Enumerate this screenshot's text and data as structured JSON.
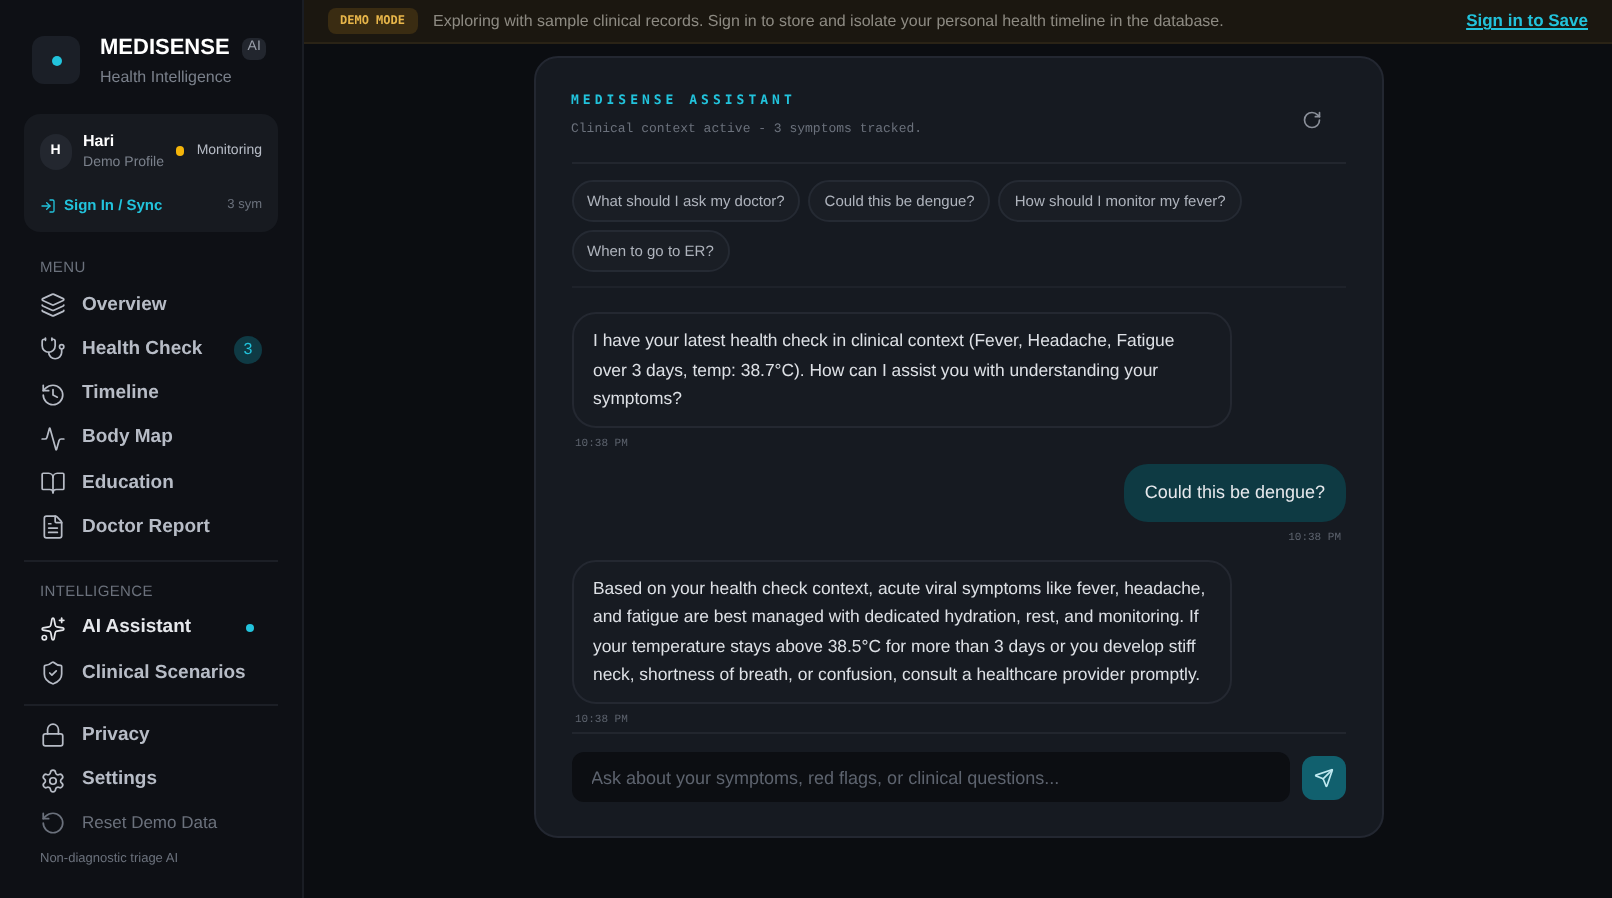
{
  "brand": {
    "name": "MEDISENSE",
    "badge": "AI",
    "tagline": "Health Intelligence"
  },
  "profile": {
    "initial": "H",
    "name": "Hari",
    "subtitle": "Demo Profile",
    "status": "Monitoring",
    "sign_in": "Sign In / Sync",
    "symptoms": "3 sym"
  },
  "menu": {
    "heading": "MENU",
    "items": [
      {
        "label": "Overview",
        "selected": false
      },
      {
        "label": "Health Check",
        "selected": false,
        "badge": "3"
      },
      {
        "label": "Timeline",
        "selected": false
      },
      {
        "label": "Body Map",
        "selected": false
      },
      {
        "label": "Education",
        "selected": false
      },
      {
        "label": "Doctor Report",
        "selected": false
      }
    ]
  },
  "intelligence": {
    "heading": "INTELLIGENCE",
    "items": [
      {
        "label": "AI Assistant",
        "selected": true
      },
      {
        "label": "Clinical Scenarios",
        "selected": false
      }
    ]
  },
  "footer_items": [
    {
      "label": "Privacy",
      "disabled": false
    },
    {
      "label": "Settings",
      "disabled": false
    },
    {
      "label": "Reset Demo Data",
      "disabled": true
    }
  ],
  "footer_note": "Non-diagnostic triage AI",
  "banner": {
    "tag": "DEMO MODE",
    "message": "Exploring with sample clinical records. Sign in to store and isolate your personal health timeline in the database.",
    "link": "Sign in to Save"
  },
  "chat": {
    "title": "MEDISENSE ASSISTANT",
    "subtitle": "Clinical context active - 3 symptoms tracked.",
    "suggestions": [
      "What should I ask my doctor?",
      "Could this be dengue?",
      "How should I monitor my fever?",
      "When to go to ER?"
    ],
    "messages": [
      {
        "kind": "assistant",
        "text": "I have your latest health check in clinical context (Fever, Headache, Fatigue over 3 days, temp: 38.7°C). How can I assist you with understanding your symptoms?",
        "time": "10:38 PM"
      },
      {
        "kind": "user",
        "text": "Could this be dengue?",
        "time": "10:38 PM"
      },
      {
        "kind": "assistant",
        "text": "Based on your health check context, acute viral symptoms like fever, headache, and fatigue are best managed with dedicated hydration, rest, and monitoring. If your temperature stays above 38.5°C for more than 3 days or you develop stiff neck, shortness of breath, or confusion, consult a healthcare provider promptly.",
        "time": "10:38 PM"
      }
    ],
    "input": {
      "placeholder": "Ask about your symptoms, red flags, or clinical questions..."
    }
  }
}
